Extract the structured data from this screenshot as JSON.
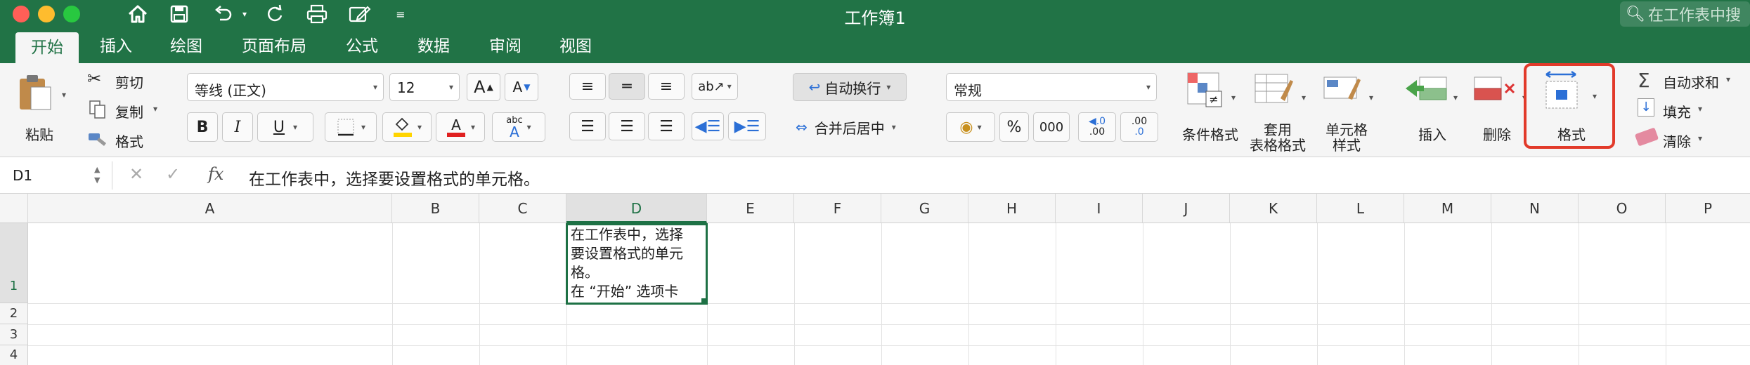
{
  "window": {
    "title": "工作簿1",
    "search_placeholder": "在工作表中搜"
  },
  "tabs": [
    "开始",
    "插入",
    "绘图",
    "页面布局",
    "公式",
    "数据",
    "审阅",
    "视图"
  ],
  "clipboard": {
    "paste": "粘贴",
    "cut": "剪切",
    "copy": "复制",
    "format": "格式"
  },
  "font": {
    "name": "等线 (正文)",
    "size": "12",
    "bold": "B",
    "italic": "I",
    "underline": "U",
    "grow": "A",
    "shrink": "A",
    "phonetic": "abc",
    "color_accent": "#e02020",
    "fill_accent": "#ffd400"
  },
  "alignment": {
    "wrap": "自动换行",
    "merge": "合并后居中"
  },
  "number": {
    "format": "常规",
    "percent": "%",
    "comma": "000",
    "inc_dec": ".00",
    "dec_dec": ".0"
  },
  "styles": {
    "conditional": "条件格式",
    "table": "套用\n表格格式",
    "cell": "单元格\n样式"
  },
  "cells": {
    "insert": "插入",
    "delete": "删除",
    "format": "格式",
    "highlight_color": "#e23a2a"
  },
  "editing": {
    "autosum": "自动求和",
    "fill": "填充",
    "clear": "清除"
  },
  "formula": {
    "name_box": "D1",
    "fx": "fx",
    "content": "在工作表中，选择要设置格式的单元格。"
  },
  "columns": [
    "A",
    "B",
    "C",
    "D",
    "E",
    "F",
    "G",
    "H",
    "I",
    "J",
    "K",
    "L",
    "M",
    "N",
    "O",
    "P"
  ],
  "rows": [
    "1",
    "2",
    "3",
    "4"
  ],
  "cell_d1": [
    "在工作表中，选择",
    "要设置格式的单元",
    "格。",
    "在 “开始” 选项卡"
  ],
  "colors": {
    "brand": "#217346",
    "selection": "#1e7145"
  }
}
